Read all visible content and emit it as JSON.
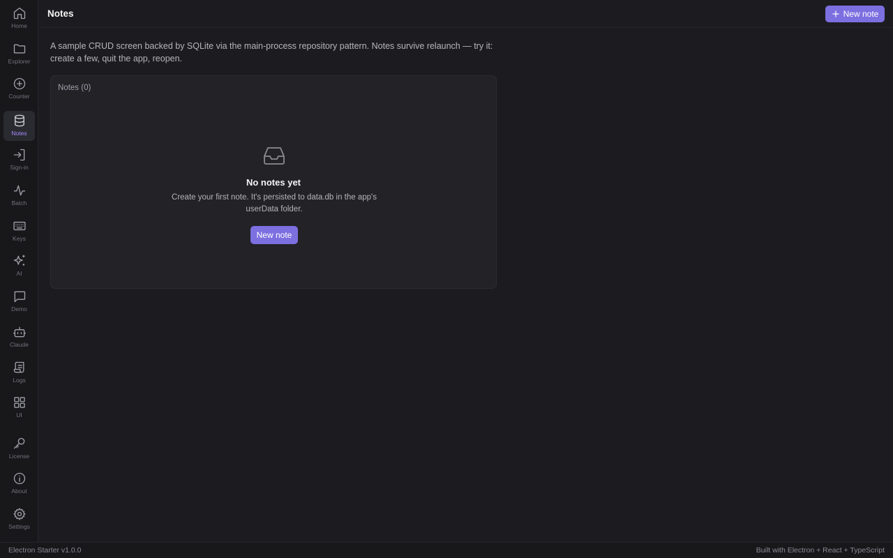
{
  "sidebar": {
    "items": [
      {
        "label": "Home",
        "icon": "home-icon"
      },
      {
        "label": "Explorer",
        "icon": "folder-icon"
      },
      {
        "label": "Counter",
        "icon": "plus-circle-icon"
      },
      {
        "label": "Notes",
        "icon": "database-icon",
        "active": true
      },
      {
        "label": "Sign-in",
        "icon": "sign-in-icon"
      },
      {
        "label": "Batch",
        "icon": "activity-icon"
      },
      {
        "label": "Keys",
        "icon": "keyboard-icon"
      },
      {
        "label": "AI",
        "icon": "sparkles-icon"
      },
      {
        "label": "Demo",
        "icon": "message-square-icon"
      },
      {
        "label": "Claude",
        "icon": "bot-icon"
      },
      {
        "label": "Logs",
        "icon": "scroll-icon"
      },
      {
        "label": "UI",
        "icon": "grid-icon"
      },
      {
        "label": "License",
        "icon": "key-icon"
      },
      {
        "label": "About",
        "icon": "info-icon"
      },
      {
        "label": "Settings",
        "icon": "gear-icon"
      }
    ]
  },
  "header": {
    "title": "Notes",
    "new_note_label": "New note"
  },
  "main": {
    "description": "A sample CRUD screen backed by SQLite via the main-process repository pattern. Notes survive relaunch — try it: create a few, quit the app, reopen.",
    "card": {
      "title": "Notes (0)",
      "empty_title": "No notes yet",
      "empty_text": "Create your first note. It's persisted to data.db in the app's userData folder.",
      "empty_button_label": "New note"
    }
  },
  "footer": {
    "left": "Electron Starter v1.0.0",
    "right": "Built with Electron + React + TypeScript"
  },
  "colors": {
    "accent": "#7c6fe0",
    "active_label": "#a78bfa",
    "background": "#1c1c20",
    "sidebar": "#18181b"
  }
}
